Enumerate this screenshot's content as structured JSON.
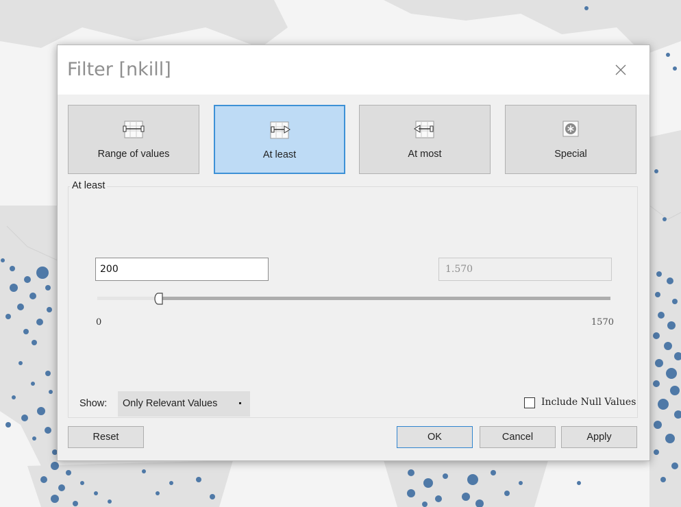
{
  "dialog": {
    "title": "Filter [nkill]",
    "close_label": "×"
  },
  "modes": [
    {
      "label": "Range of values",
      "icon": "range-of-values-icon",
      "selected": false
    },
    {
      "label": "At least",
      "icon": "at-least-icon",
      "selected": true
    },
    {
      "label": "At most",
      "icon": "at-most-icon",
      "selected": false
    },
    {
      "label": "Special",
      "icon": "special-icon",
      "selected": false
    }
  ],
  "group": {
    "legend": "At least"
  },
  "range": {
    "value": "200",
    "max_display": "1.570",
    "min_label": "0",
    "max_label": "1570",
    "slider_min": 0,
    "slider_max": 1570,
    "slider_value": 200
  },
  "show": {
    "label": "Show:",
    "selected": "Only Relevant Values"
  },
  "include_null": {
    "label": "Include Null Values",
    "checked": false
  },
  "buttons": {
    "reset": "Reset",
    "ok": "OK",
    "cancel": "Cancel",
    "apply": "Apply"
  },
  "colors": {
    "selected_mode_bg": "#bedbf5",
    "selected_mode_border": "#3d91d6",
    "map_land": "#e1e1e1",
    "map_dots": "#4f79a7"
  }
}
